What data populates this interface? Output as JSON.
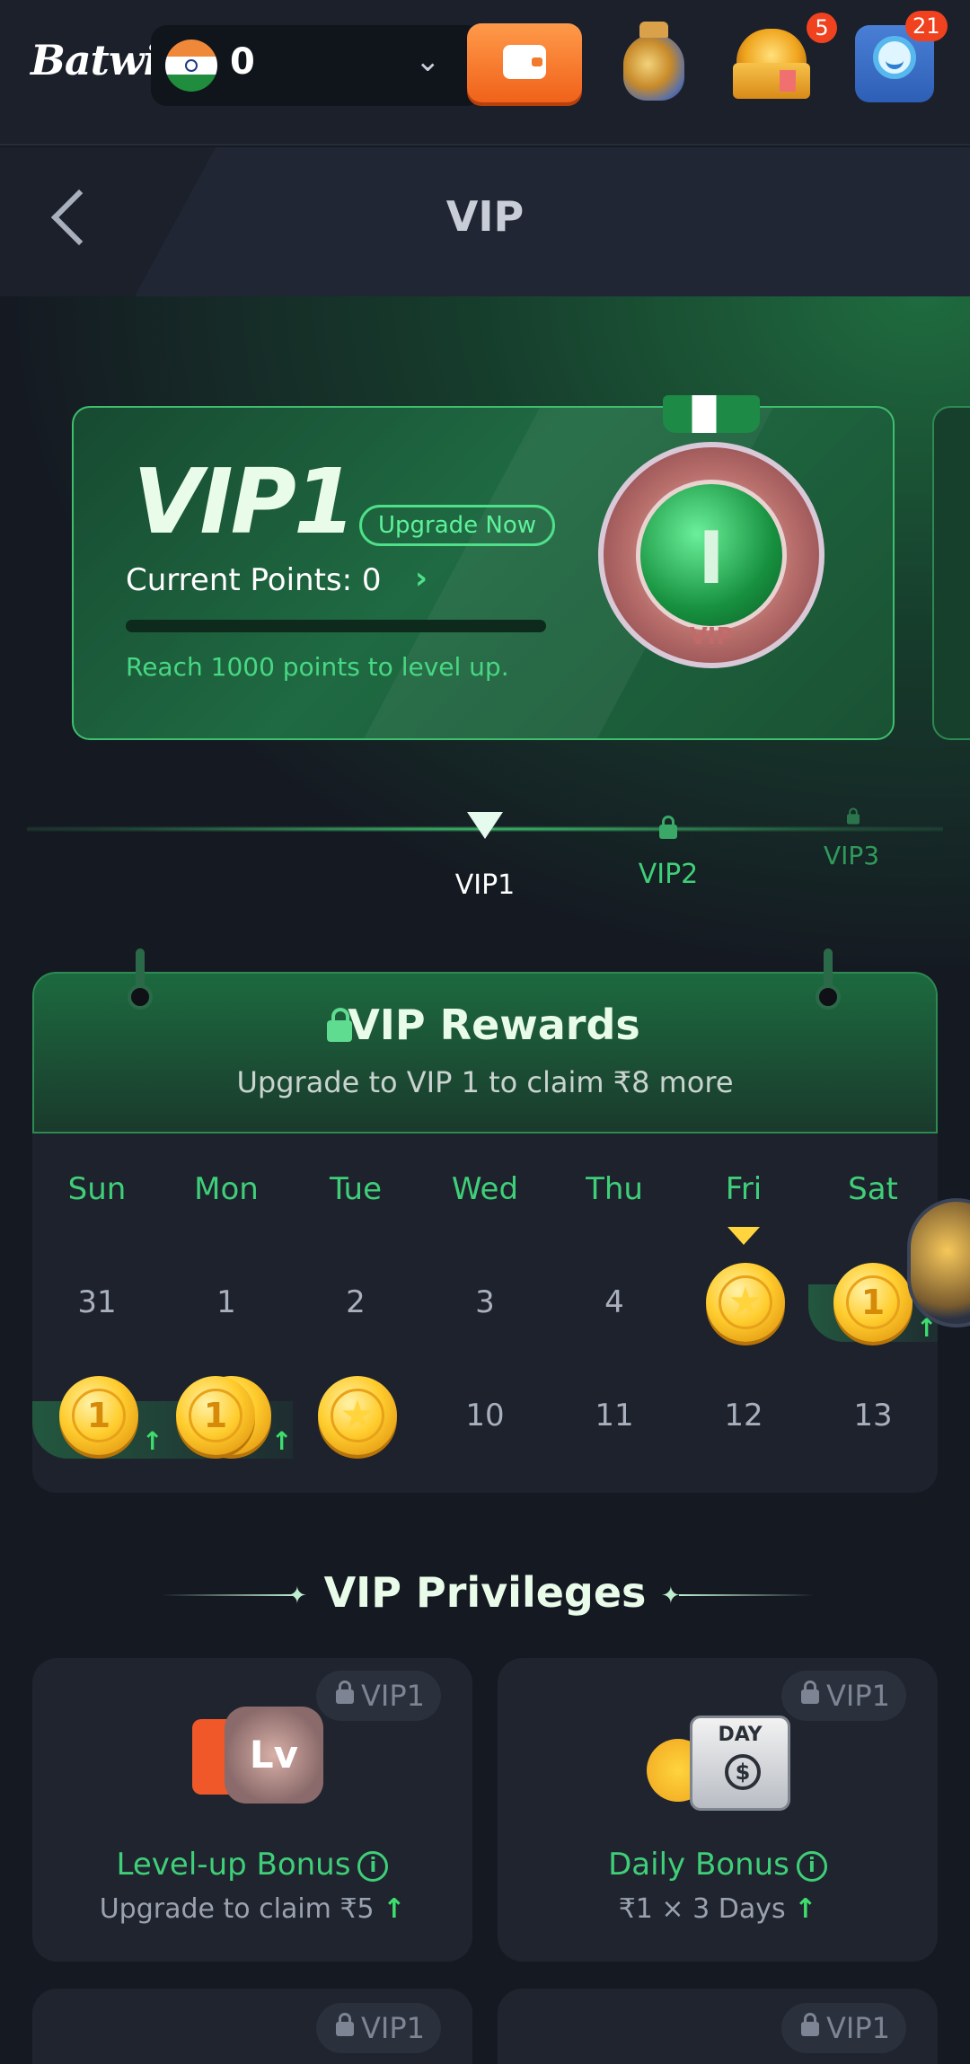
{
  "header": {
    "logo": "Batwin",
    "balance": "0",
    "notification_badges": {
      "chest": "5",
      "support": "21"
    }
  },
  "page": {
    "title": "VIP"
  },
  "vip_card": {
    "level": "VIP1",
    "upgrade_label": "Upgrade Now",
    "current_points_label": "Current Points: 0",
    "progress_fraction": 0,
    "reach_text": "Reach 1000 points to level up.",
    "medal_number": "I",
    "medal_text": "VIP"
  },
  "level_tabs": [
    "VIP1",
    "VIP2",
    "VIP3"
  ],
  "rewards": {
    "title": "VIP Rewards",
    "subtitle": "Upgrade to VIP 1 to claim ₹8 more",
    "days": [
      "Sun",
      "Mon",
      "Tue",
      "Wed",
      "Thu",
      "Fri",
      "Sat"
    ],
    "week1": [
      "31",
      "1",
      "2",
      "3",
      "4"
    ],
    "week2": [
      "10",
      "11",
      "12",
      "13"
    ],
    "coin_label": "1"
  },
  "privileges": {
    "title": "VIP Privileges",
    "items": [
      {
        "tag": "VIP1",
        "name": "Level-up Bonus",
        "desc": "Upgrade to claim ₹5",
        "icon_text": "Lv"
      },
      {
        "tag": "VIP1",
        "name": "Daily Bonus",
        "desc": "₹1 × 3 Days",
        "icon_text": "DAY"
      },
      {
        "tag": "VIP1"
      },
      {
        "tag": "VIP1"
      }
    ]
  },
  "colors": {
    "accent_green": "#3fcf78",
    "orange": "#f0621a",
    "gold": "#ffcd2e"
  }
}
